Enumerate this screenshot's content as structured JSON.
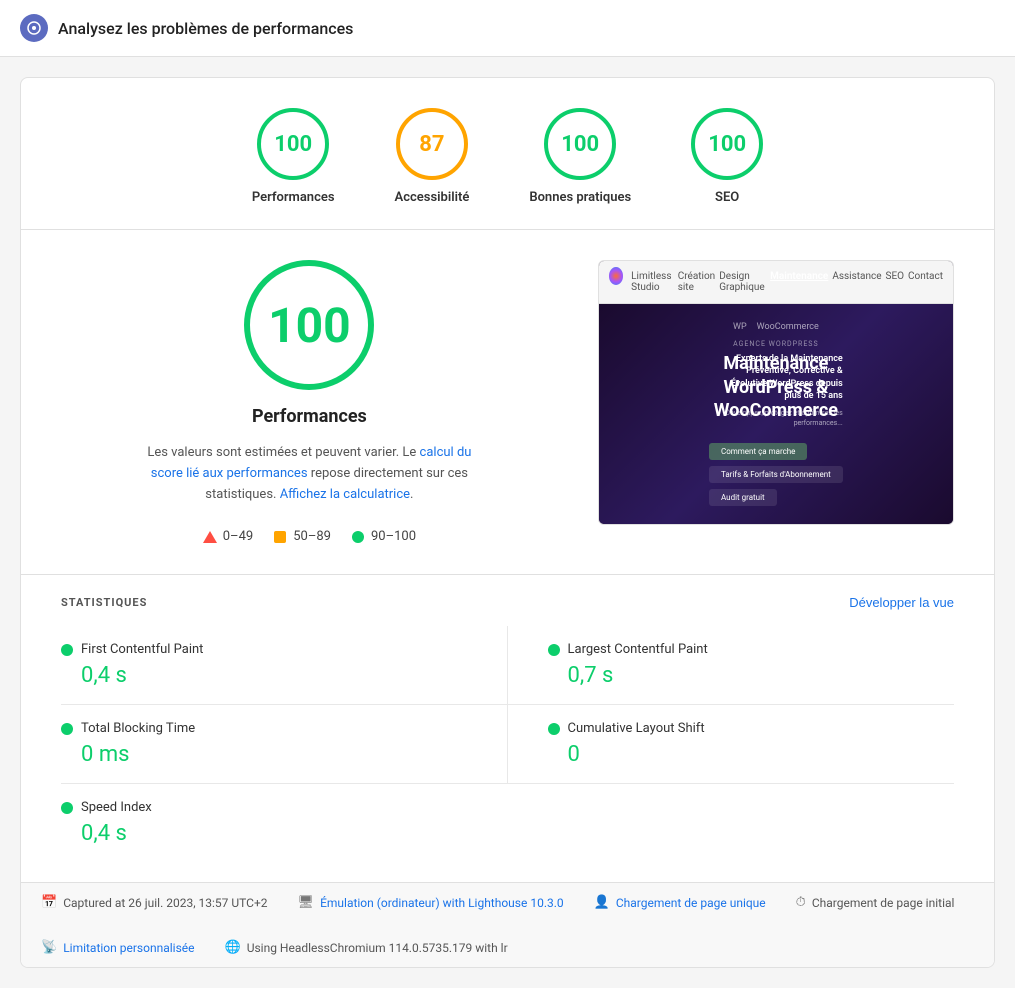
{
  "header": {
    "title": "Analysez les problèmes de performances",
    "icon_label": "performance-icon"
  },
  "scores": [
    {
      "id": "performances",
      "value": "100",
      "label": "Performances",
      "color": "green"
    },
    {
      "id": "accessibility",
      "value": "87",
      "label": "Accessibilité",
      "color": "orange"
    },
    {
      "id": "best-practices",
      "value": "100",
      "label": "Bonnes pratiques",
      "color": "green"
    },
    {
      "id": "seo",
      "value": "100",
      "label": "SEO",
      "color": "green"
    }
  ],
  "main_score": {
    "value": "100",
    "title": "Performances",
    "description_part1": "Les valeurs sont estimées et peuvent varier. Le",
    "link1_text": "calcul du score lié aux performances",
    "description_part2": "repose directement sur ces statistiques.",
    "link2_text": "Affichez la calculatrice",
    "legend": [
      {
        "type": "triangle",
        "range": "0–49"
      },
      {
        "type": "square",
        "range": "50–89"
      },
      {
        "type": "circle",
        "range": "90–100"
      }
    ]
  },
  "screenshot": {
    "nav_links": [
      "Limitless Studio",
      "Création site",
      "Design Graphique",
      "Maintenance",
      "Assistance",
      "SEO",
      "Contact"
    ],
    "active_nav": "Maintenance",
    "tag": "AGENCE WORDPRESS",
    "heading": "Maintenance\nWordPress &\nWooCommerce",
    "body_text": "Experts de la Maintenance\nPréventive, Corrective &\nÉvolutive WordPress depuis\nplus de 15 ans",
    "buttons": [
      "Comment ça marche",
      "Tarifs & Forfaits d'Abonnement",
      "Audit gratuit"
    ]
  },
  "stats": {
    "title": "STATISTIQUES",
    "expand_label": "Développer la vue",
    "items": [
      {
        "id": "fcp",
        "name": "First Contentful Paint",
        "value": "0,4 s",
        "color": "green"
      },
      {
        "id": "lcp",
        "name": "Largest Contentful Paint",
        "value": "0,7 s",
        "color": "green"
      },
      {
        "id": "tbt",
        "name": "Total Blocking Time",
        "value": "0 ms",
        "color": "green"
      },
      {
        "id": "cls",
        "name": "Cumulative Layout Shift",
        "value": "0",
        "color": "green"
      },
      {
        "id": "si",
        "name": "Speed Index",
        "value": "0,4 s",
        "color": "green"
      }
    ]
  },
  "footer": {
    "items": [
      {
        "icon": "📅",
        "text": "Captured at 26 juil. 2023, 13:57 UTC+2"
      },
      {
        "icon": "🖥",
        "text": "Émulation (ordinateur) with Lighthouse 10.3.0",
        "is_link": true
      },
      {
        "icon": "👤",
        "text": "Chargement de page unique",
        "is_link": true
      },
      {
        "icon": "⏱",
        "text": "Chargement de page initial"
      },
      {
        "icon": "📡",
        "text": "Limitation personnalisée",
        "is_link": true
      },
      {
        "icon": "🌐",
        "text": "Using HeadlessChromium 114.0.5735.179 with lr"
      }
    ]
  }
}
